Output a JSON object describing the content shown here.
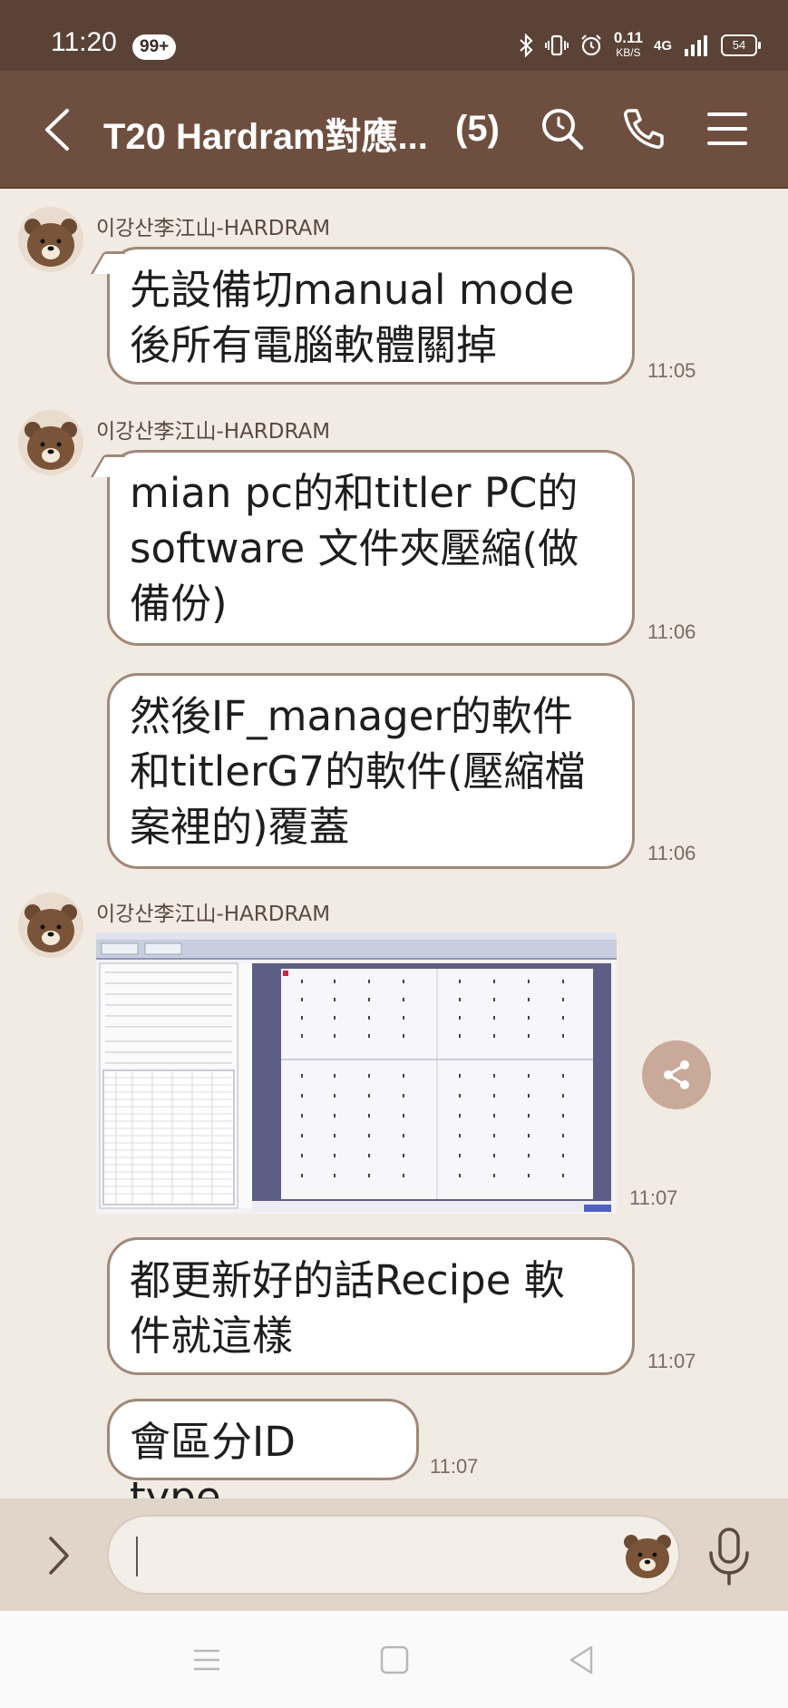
{
  "status_bar": {
    "time": "11:20",
    "notif_badge": "99+",
    "speed_value": "0.11",
    "speed_unit": "KB/S",
    "network": "4G",
    "battery": "54"
  },
  "header": {
    "title": "T20 Hardram對應...",
    "member_count": "(5)"
  },
  "messages": [
    {
      "sender": "이강산李江山-HARDRAM",
      "text": "先設備切manual mode\n後所有電腦軟體關掉",
      "time": "11:05"
    },
    {
      "sender": "이강산李江山-HARDRAM",
      "text": "mian pc的和titler PC的\nsoftware 文件夾壓縮(做\n備份)",
      "time": "11:06"
    },
    {
      "text": "然後IF_manager的軟件\n和titlerG7的軟件(壓縮檔\n案裡的)覆蓋",
      "time": "11:06"
    },
    {
      "sender": "이강산李江山-HARDRAM",
      "type": "image",
      "time": "11:07"
    },
    {
      "text": "都更新好的話Recipe 軟\n件就這樣",
      "time": "11:07"
    },
    {
      "text": "會區分ID type",
      "time": "11:07"
    }
  ],
  "colors": {
    "header": "#6e4f3f",
    "status_bar": "#5a4236",
    "chat_bg": "#f1ebe4",
    "bubble_border": "#a08878",
    "input_bar": "#e1d4c9"
  }
}
